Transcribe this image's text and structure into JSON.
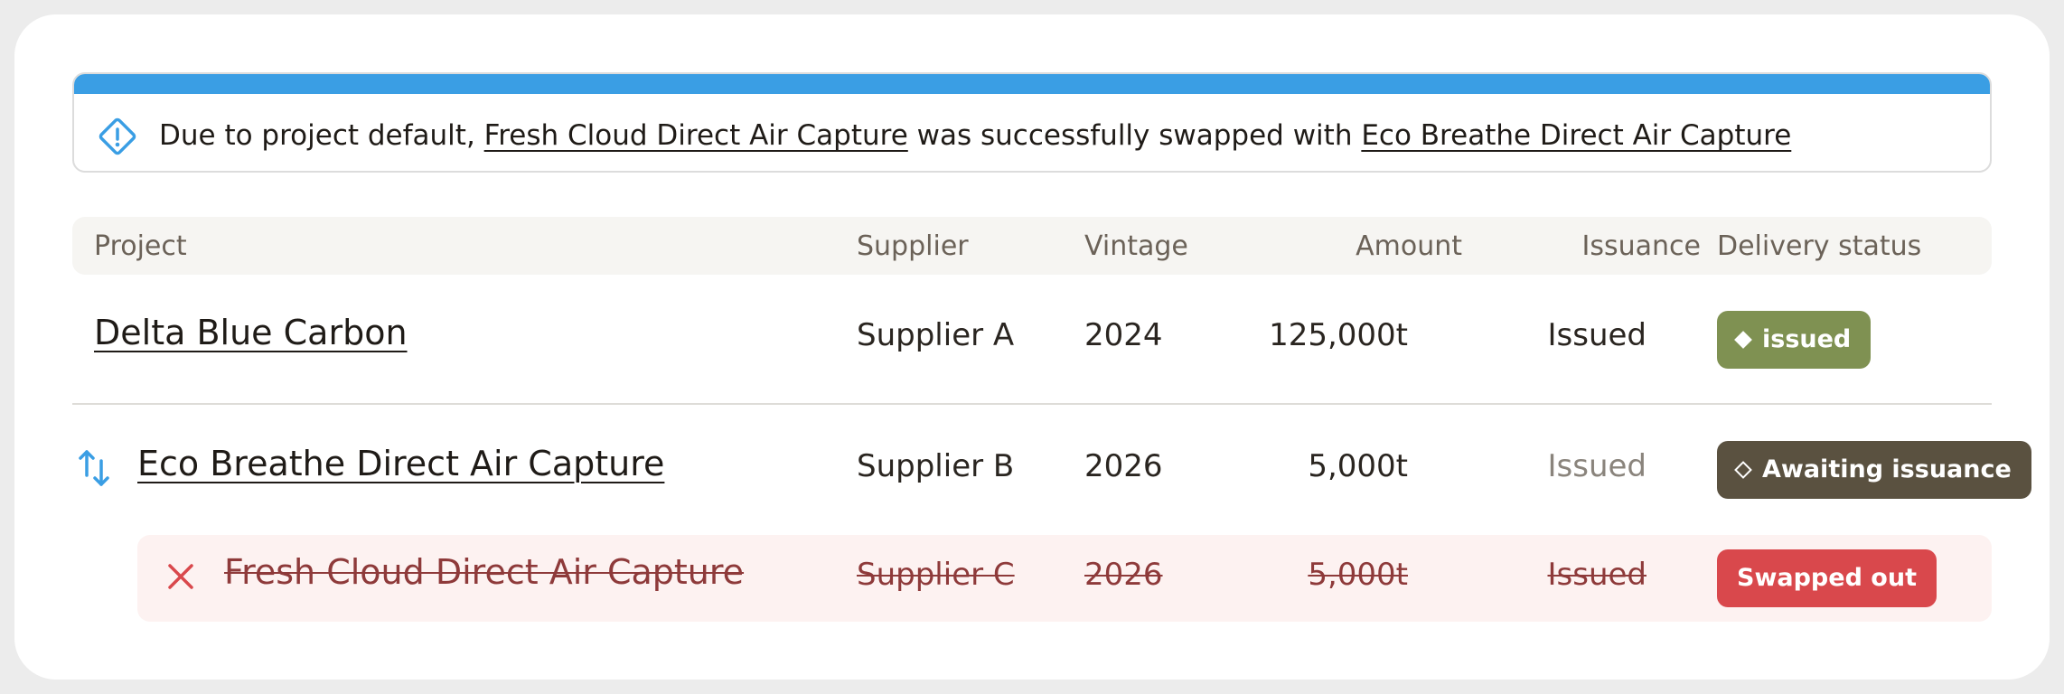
{
  "notice": {
    "prefix": "Due to project default,",
    "from_project": "Fresh Cloud Direct Air Capture",
    "middle": "was successfully swapped with",
    "to_project": "Eco Breathe Direct Air Capture",
    "icon": "alert-diamond-icon",
    "accent_color": "#3a9ee4"
  },
  "table": {
    "columns": {
      "project": "Project",
      "supplier": "Supplier",
      "vintage": "Vintage",
      "amount": "Amount",
      "issuance": "Issuance",
      "delivery_status": "Delivery status"
    },
    "rows": [
      {
        "project": "Delta Blue Carbon",
        "supplier": "Supplier A",
        "vintage": "2024",
        "amount": "125,000t",
        "issuance": "Issued",
        "status": "issued",
        "status_color": "#7f9152"
      },
      {
        "project": "Eco Breathe Direct Air Capture",
        "supplier": "Supplier B",
        "vintage": "2026",
        "amount": "5,000t",
        "issuance": "Issued",
        "status": "Awaiting issuance",
        "status_color": "#5a5140",
        "row_icon": "swap-arrows-icon"
      },
      {
        "project": "Fresh Cloud Direct Air Capture",
        "supplier": "Supplier C",
        "vintage": "2026",
        "amount": "5,000t",
        "issuance": "Issued",
        "status": "Swapped out",
        "status_color": "#d9484c",
        "row_icon": "close-x-icon"
      }
    ]
  }
}
